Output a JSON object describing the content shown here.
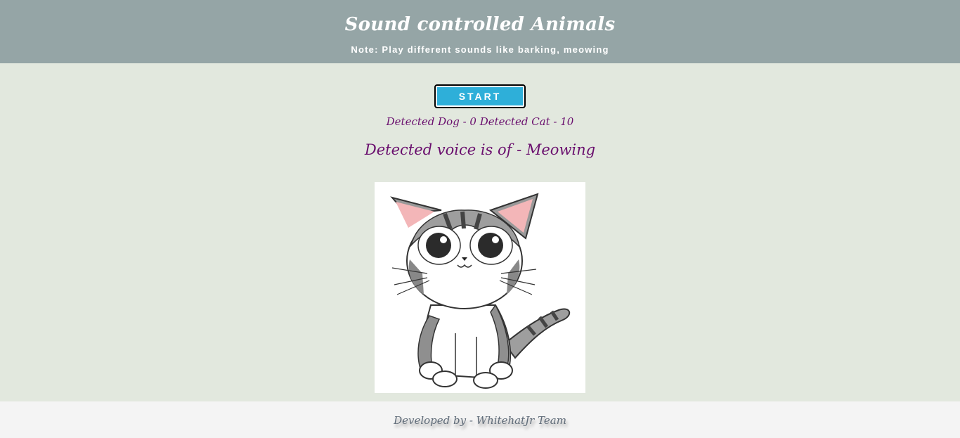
{
  "header": {
    "title": "Sound controlled Animals",
    "note": "Note: Play different sounds like barking, meowing"
  },
  "controls": {
    "start_label": "START"
  },
  "status": {
    "counts_text": "Detected Dog - 0 Detected Cat - 10",
    "voice_text": "Detected voice is of - Meowing"
  },
  "image": {
    "subject": "cartoon-cat-icon"
  },
  "footer": {
    "text": "Developed by - WhitehatJr Team"
  },
  "colors": {
    "header_bg": "#95a5a6",
    "page_bg": "#e2e8de",
    "button_bg": "#2eafd9",
    "status_text": "#6a0f6e",
    "footer_bg": "#f4f4f4"
  }
}
